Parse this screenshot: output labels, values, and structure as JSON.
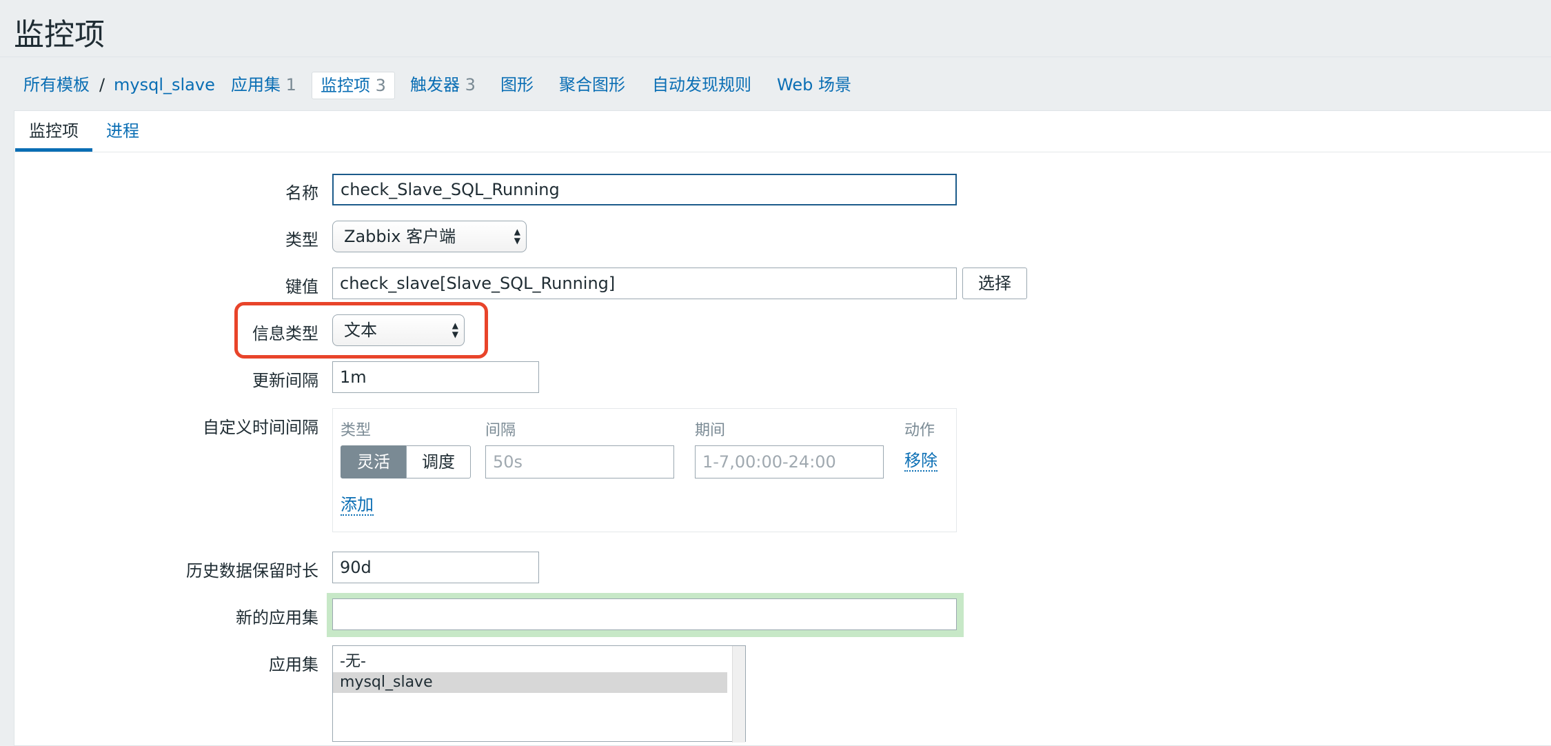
{
  "page": {
    "title": "监控项"
  },
  "breadcrumbs": {
    "all_templates": "所有模板",
    "separator": "/",
    "template": "mysql_slave",
    "applications": "应用集",
    "applications_count": "1",
    "items": "监控项",
    "items_count": "3",
    "triggers": "触发器",
    "triggers_count": "3",
    "graphs": "图形",
    "screens": "聚合图形",
    "discovery": "自动发现规则",
    "web": "Web 场景"
  },
  "tabs": {
    "item": "监控项",
    "process": "进程"
  },
  "form": {
    "name_label": "名称",
    "name_value": "check_Slave_SQL_Running",
    "type_label": "类型",
    "type_value": "Zabbix 客户端",
    "key_label": "键值",
    "key_value": "check_slave[Slave_SQL_Running]",
    "key_select_button": "选择",
    "info_type_label": "信息类型",
    "info_type_value": "文本",
    "update_interval_label": "更新间隔",
    "update_interval_value": "1m",
    "custom_intervals_label": "自定义时间间隔",
    "custom_intervals": {
      "col_type": "类型",
      "col_interval": "间隔",
      "col_period": "期间",
      "col_action": "动作",
      "flexible": "灵活",
      "scheduling": "调度",
      "interval_placeholder": "50s",
      "period_placeholder": "1-7,00:00-24:00",
      "remove": "移除",
      "add": "添加"
    },
    "history_label": "历史数据保留时长",
    "history_value": "90d",
    "new_application_label": "新的应用集",
    "new_application_value": "",
    "applications_label": "应用集",
    "applications_options": [
      "-无-",
      "mysql_slave"
    ]
  },
  "colors": {
    "link": "#0a6eb4",
    "highlight": "#e8442a",
    "active_segment": "#7a8a94"
  }
}
